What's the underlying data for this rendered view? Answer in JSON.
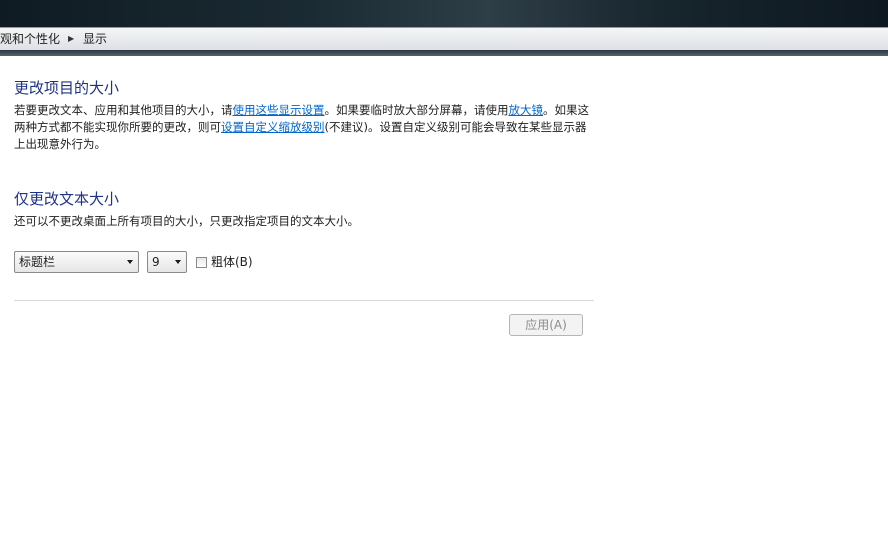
{
  "breadcrumb": {
    "parent": "观和个性化",
    "current": "显示"
  },
  "section_size": {
    "title": "更改项目的大小",
    "desc_1": "若要更改文本、应用和其他项目的大小，请",
    "link_display": "使用这些显示设置",
    "desc_2": "。如果要临时放大部分屏幕，请使用",
    "link_magnifier": "放大镜",
    "desc_3": "。如果这两种方式都不能实现你所要的更改，则可",
    "link_custom": "设置自定义缩放级别",
    "desc_4": "(不建议)。设置自定义级别可能会导致在某些显示器上出现意外行为。"
  },
  "section_text": {
    "title": "仅更改文本大小",
    "desc": "还可以不更改桌面上所有项目的大小，只更改指定项目的文本大小。",
    "item_select": "标题栏",
    "size_select": "9",
    "bold_label": "粗体(B)",
    "bold_checked": false
  },
  "footer": {
    "apply_label": "应用(A)",
    "apply_enabled": false
  }
}
